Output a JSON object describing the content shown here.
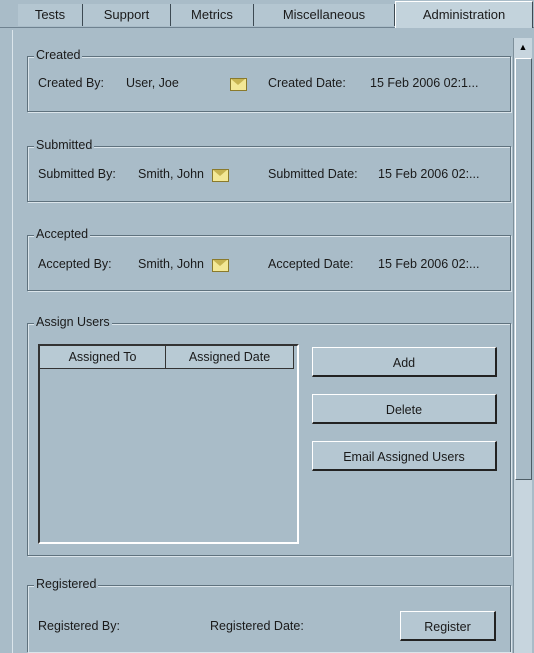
{
  "tabs": [
    "Tests",
    "Support",
    "Metrics",
    "Miscellaneous",
    "Administration"
  ],
  "created": {
    "legend": "Created",
    "by_label": "Created By:",
    "by_value": "User, Joe",
    "date_label": "Created Date:",
    "date_value": "15 Feb 2006 02:1..."
  },
  "submitted": {
    "legend": "Submitted",
    "by_label": "Submitted By:",
    "by_value": "Smith, John",
    "date_label": "Submitted Date:",
    "date_value": "15 Feb 2006 02:..."
  },
  "accepted": {
    "legend": "Accepted",
    "by_label": "Accepted By:",
    "by_value": "Smith, John",
    "date_label": "Accepted Date:",
    "date_value": "15 Feb 2006 02:..."
  },
  "assign": {
    "legend": "Assign Users",
    "col_assigned_to": "Assigned To",
    "col_assigned_date": "Assigned Date",
    "add": "Add",
    "delete": "Delete",
    "email": "Email Assigned Users"
  },
  "registered": {
    "legend": "Registered",
    "by_label": "Registered By:",
    "date_label": "Registered Date:",
    "register": "Register"
  },
  "icons": {
    "mail": "mail-envelope-icon",
    "scroll_up": "scroll-up-arrow-icon"
  },
  "colors": {
    "background": "#a9bcc8",
    "envelope": "#f3e896"
  }
}
